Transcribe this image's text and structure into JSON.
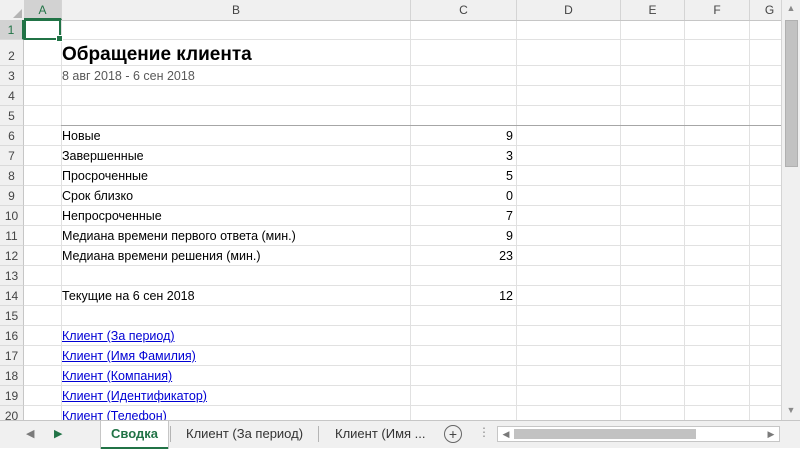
{
  "columns": [
    "A",
    "B",
    "C",
    "D",
    "E",
    "F",
    "G"
  ],
  "rows": [
    "1",
    "2",
    "3",
    "4",
    "5",
    "6",
    "7",
    "8",
    "9",
    "10",
    "11",
    "12",
    "13",
    "14",
    "15",
    "16",
    "17",
    "18",
    "19",
    "20"
  ],
  "report": {
    "title": "Обращение клиента",
    "date_range": "8 авг 2018 - 6 сен 2018"
  },
  "metrics": [
    {
      "label": "Новые",
      "value": "9"
    },
    {
      "label": "Завершенные",
      "value": "3"
    },
    {
      "label": "Просроченные",
      "value": "5"
    },
    {
      "label": "Срок близко",
      "value": "0"
    },
    {
      "label": "Непросроченные",
      "value": "7"
    },
    {
      "label": "Медиана времени первого ответа (мин.)",
      "value": "9"
    },
    {
      "label": "Медиана времени решения (мин.)",
      "value": "23"
    }
  ],
  "current": {
    "label": "Текущие на 6 сен 2018",
    "value": "12"
  },
  "links": [
    "Клиент (За период)",
    "Клиент (Имя Фамилия)",
    "Клиент (Компания)",
    "Клиент (Идентификатор)",
    "Клиент (Телефон)"
  ],
  "sheet_tabs": [
    {
      "label": "Сводка",
      "active": true
    },
    {
      "label": "Клиент (За период)",
      "active": false
    },
    {
      "label": "Клиент (Имя ...",
      "active": false
    }
  ],
  "icons": {
    "add_sheet": "plus-circle-icon",
    "scroll_left": "triangle-left-icon",
    "scroll_right": "triangle-right-icon"
  },
  "colors": {
    "accent": "#217346",
    "link": "#0000d4"
  }
}
